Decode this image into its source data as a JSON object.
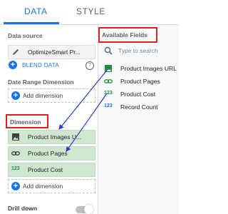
{
  "tabs": {
    "data": "DATA",
    "style": "STYLE"
  },
  "data_source": {
    "label": "Data source",
    "name": "OptimizeSmart Pr...",
    "blend_label": "BLEND DATA"
  },
  "date_range": {
    "label": "Date Range Dimension",
    "add_label": "Add dimension"
  },
  "dimension": {
    "label": "Dimension",
    "items": [
      {
        "label": "Product Images U...",
        "icon": "image-icon"
      },
      {
        "label": "Product Pages",
        "icon": "link-icon"
      },
      {
        "label": "Product Cost",
        "icon": "number-icon"
      }
    ],
    "add_label": "Add dimension"
  },
  "drill_down": {
    "label": "Drill down",
    "enabled": false
  },
  "available_fields": {
    "title": "Available Fields",
    "search_placeholder": "Type to search",
    "fields": [
      {
        "label": "Product Images URL",
        "icon": "image-icon"
      },
      {
        "label": "Product Pages",
        "icon": "link-icon"
      },
      {
        "label": "Product Cost",
        "icon": "number-icon"
      },
      {
        "label": "Record Count",
        "icon": "number-icon"
      }
    ]
  },
  "colors": {
    "accent": "#1a73e8",
    "highlight": "#e02020",
    "chip_background": "#cfe6cf",
    "dimension_icon": "#1e8e3e"
  },
  "glyphs": {
    "plus": "+",
    "number": "123",
    "help": "?"
  }
}
